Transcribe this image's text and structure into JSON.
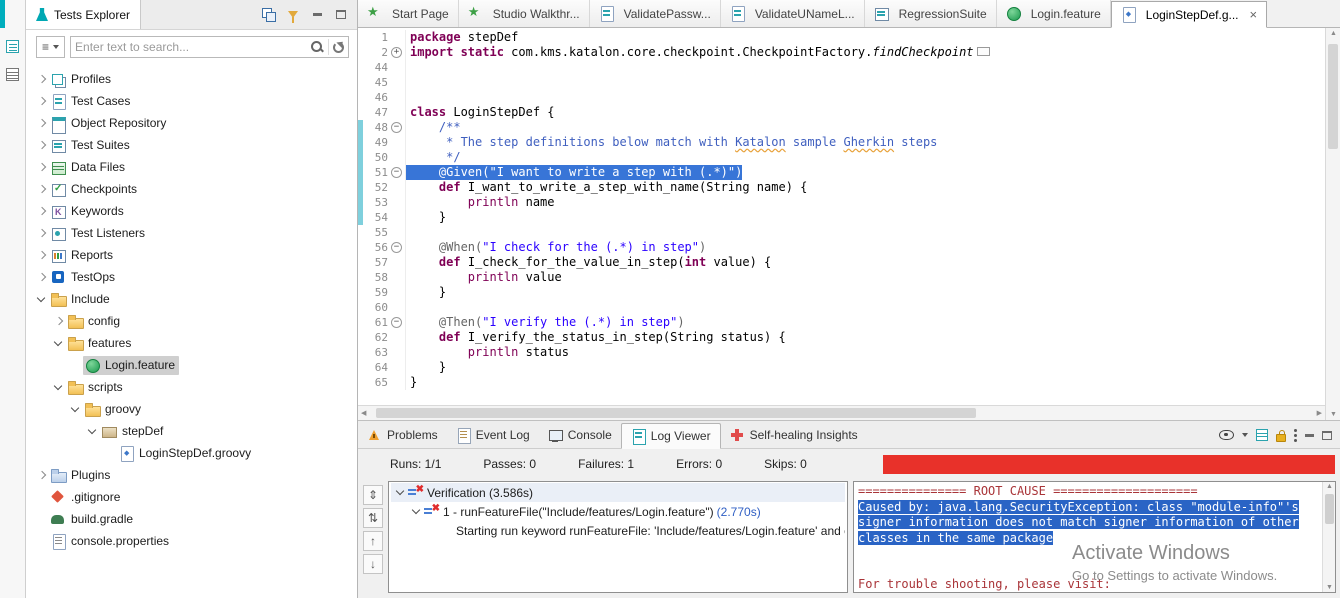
{
  "colors": {
    "accent_teal": "#00aebd",
    "selection_blue": "#3875d7",
    "console_selection": "#2a64c5",
    "failure_red": "#e8312a",
    "keyword_purple": "#7f0055",
    "string_blue": "#2a00ff",
    "comment_blue": "#3f5fbf",
    "root_cause_red": "#a93438"
  },
  "explorer": {
    "tab": "Tests Explorer",
    "search_placeholder": "Enter text to search...",
    "tree": [
      {
        "label": "Profiles",
        "icon": "profiles",
        "lvl": 0,
        "ch": "c"
      },
      {
        "label": "Test Cases",
        "icon": "testcase",
        "lvl": 0,
        "ch": "c"
      },
      {
        "label": "Object Repository",
        "icon": "objrepo",
        "lvl": 0,
        "ch": "c"
      },
      {
        "label": "Test Suites",
        "icon": "suite",
        "lvl": 0,
        "ch": "c"
      },
      {
        "label": "Data Files",
        "icon": "datafile",
        "lvl": 0,
        "ch": "c"
      },
      {
        "label": "Checkpoints",
        "icon": "checkpoint",
        "lvl": 0,
        "ch": "c"
      },
      {
        "label": "Keywords",
        "icon": "keyword",
        "lvl": 0,
        "ch": "c"
      },
      {
        "label": "Test Listeners",
        "icon": "listener",
        "lvl": 0,
        "ch": "c"
      },
      {
        "label": "Reports",
        "icon": "report",
        "lvl": 0,
        "ch": "c"
      },
      {
        "label": "TestOps",
        "icon": "testops",
        "lvl": 0,
        "ch": "c"
      },
      {
        "label": "Include",
        "icon": "folder",
        "lvl": 0,
        "ch": "e"
      },
      {
        "label": "config",
        "icon": "folder",
        "lvl": 1,
        "ch": "c"
      },
      {
        "label": "features",
        "icon": "folder",
        "lvl": 1,
        "ch": "e"
      },
      {
        "label": "Login.feature",
        "icon": "feature",
        "lvl": 2,
        "ch": "n",
        "selected": true
      },
      {
        "label": "scripts",
        "icon": "folder",
        "lvl": 1,
        "ch": "e"
      },
      {
        "label": "groovy",
        "icon": "folder",
        "lvl": 2,
        "ch": "e"
      },
      {
        "label": "stepDef",
        "icon": "stepdef",
        "lvl": 3,
        "ch": "e"
      },
      {
        "label": "LoginStepDef.groovy",
        "icon": "groovyfile",
        "lvl": 4,
        "ch": "n"
      },
      {
        "label": "Plugins",
        "icon": "plugins",
        "lvl": 0,
        "ch": "c"
      },
      {
        "label": ".gitignore",
        "icon": "git",
        "lvl": 0,
        "ch": "n"
      },
      {
        "label": "build.gradle",
        "icon": "gradle",
        "lvl": 0,
        "ch": "n"
      },
      {
        "label": "console.properties",
        "icon": "props",
        "lvl": 0,
        "ch": "n"
      }
    ]
  },
  "editor": {
    "close_glyph": "×",
    "tabs": [
      {
        "label": "Start Page",
        "icon": "star"
      },
      {
        "label": "Studio Walkthr...",
        "icon": "star"
      },
      {
        "label": "ValidatePassw...",
        "icon": "testcase2"
      },
      {
        "label": "ValidateUNameL...",
        "icon": "testcase2"
      },
      {
        "label": "RegressionSuite",
        "icon": "suite2"
      },
      {
        "label": "Login.feature",
        "icon": "feature"
      },
      {
        "label": "LoginStepDef.g...",
        "icon": "groovyfile",
        "active": true
      }
    ],
    "lines": [
      {
        "num": "1",
        "tokens": [
          [
            "kw",
            "package"
          ],
          [
            "pl",
            " stepDef"
          ]
        ]
      },
      {
        "num": "2",
        "fold": "+",
        "tokens": [
          [
            "kw",
            "import static"
          ],
          [
            "pl",
            " com.kms.katalon.core.checkpoint.CheckpointFactory."
          ],
          [
            "it",
            "findCheckpoint"
          ],
          [
            "box",
            ""
          ]
        ]
      },
      {
        "num": "44",
        "tokens": []
      },
      {
        "num": "45",
        "tokens": []
      },
      {
        "num": "46",
        "tokens": []
      },
      {
        "num": "47",
        "tokens": [
          [
            "kw",
            "class"
          ],
          [
            "pl",
            " LoginStepDef {"
          ]
        ]
      },
      {
        "num": "48",
        "fold": "-",
        "chg": true,
        "tokens": [
          [
            "cm",
            "    /**"
          ]
        ]
      },
      {
        "num": "49",
        "chg": true,
        "tokens": [
          [
            "cm",
            "     * The step definitions below match with "
          ],
          [
            "cmw",
            "Katalon"
          ],
          [
            "cm",
            " sample "
          ],
          [
            "cmw",
            "Gherkin"
          ],
          [
            "cm",
            " steps"
          ]
        ]
      },
      {
        "num": "50",
        "chg": true,
        "tokens": [
          [
            "cm",
            "     */"
          ]
        ]
      },
      {
        "num": "51",
        "fold": "-",
        "chg": true,
        "sel": true,
        "tokens": [
          [
            "ann",
            "    @Given("
          ],
          [
            "str",
            "\"I want to write a step with (.*)\""
          ],
          [
            "ann",
            ")"
          ]
        ]
      },
      {
        "num": "52",
        "chg": true,
        "tokens": [
          [
            "pl",
            "    "
          ],
          [
            "kw",
            "def"
          ],
          [
            "pl",
            " I_want_to_write_a_step_with_name(String name) {"
          ]
        ]
      },
      {
        "num": "53",
        "chg": true,
        "tokens": [
          [
            "pl",
            "        "
          ],
          [
            "kw2",
            "println"
          ],
          [
            "pl",
            " name"
          ]
        ]
      },
      {
        "num": "54",
        "chg": true,
        "tokens": [
          [
            "pl",
            "    }"
          ]
        ]
      },
      {
        "num": "55",
        "tokens": []
      },
      {
        "num": "56",
        "fold": "-",
        "tokens": [
          [
            "ann",
            "    @When("
          ],
          [
            "str",
            "\"I check for the (.*) in step\""
          ],
          [
            "ann",
            ")"
          ]
        ]
      },
      {
        "num": "57",
        "tokens": [
          [
            "pl",
            "    "
          ],
          [
            "kw",
            "def"
          ],
          [
            "pl",
            " I_check_for_the_value_in_step("
          ],
          [
            "kw",
            "int"
          ],
          [
            "pl",
            " value) {"
          ]
        ]
      },
      {
        "num": "58",
        "tokens": [
          [
            "pl",
            "        "
          ],
          [
            "kw2",
            "println"
          ],
          [
            "pl",
            " value"
          ]
        ]
      },
      {
        "num": "59",
        "tokens": [
          [
            "pl",
            "    }"
          ]
        ]
      },
      {
        "num": "60",
        "tokens": []
      },
      {
        "num": "61",
        "fold": "-",
        "tokens": [
          [
            "ann",
            "    @Then("
          ],
          [
            "str",
            "\"I verify the (.*) in step\""
          ],
          [
            "ann",
            ")"
          ]
        ]
      },
      {
        "num": "62",
        "tokens": [
          [
            "pl",
            "    "
          ],
          [
            "kw",
            "def"
          ],
          [
            "pl",
            " I_verify_the_status_in_step(String status) {"
          ]
        ]
      },
      {
        "num": "63",
        "tokens": [
          [
            "pl",
            "        "
          ],
          [
            "kw2",
            "println"
          ],
          [
            "pl",
            " status"
          ]
        ]
      },
      {
        "num": "64",
        "tokens": [
          [
            "pl",
            "    }"
          ]
        ]
      },
      {
        "num": "65",
        "tokens": [
          [
            "pl",
            "}"
          ]
        ]
      }
    ]
  },
  "bottom": {
    "tabs": [
      {
        "label": "Problems",
        "icon": "problems"
      },
      {
        "label": "Event Log",
        "icon": "eventlog"
      },
      {
        "label": "Console",
        "icon": "console"
      },
      {
        "label": "Log Viewer",
        "icon": "logviewer",
        "active": true
      },
      {
        "label": "Self-healing Insights",
        "icon": "selfheal"
      }
    ],
    "stats": [
      "Runs: 1/1",
      "Passes: 0",
      "Failures: 1",
      "Errors: 0",
      "Skips: 0"
    ],
    "tools": [
      {
        "name": "expand-collapse",
        "glyph": "⇕"
      },
      {
        "name": "scroll-sync",
        "glyph": "⇅"
      },
      {
        "name": "previous-failure",
        "glyph": "↑"
      },
      {
        "name": "next-failure",
        "glyph": "↓"
      }
    ],
    "log_tree": [
      {
        "lvl": 0,
        "chev": true,
        "icon": true,
        "text": "Verification (3.586s)",
        "hl": true
      },
      {
        "lvl": 1,
        "chev": true,
        "icon": true,
        "text": "1 - runFeatureFile(\"Include/features/Login.feature\")",
        "time": "(2.770s)"
      },
      {
        "lvl": 3,
        "chev": false,
        "icon": false,
        "text": "Starting run keyword runFeatureFile: 'Include/features/Login.feature' and e"
      }
    ],
    "console": {
      "lines": [
        {
          "s": "err",
          "t": "=============== ROOT CAUSE ===================="
        },
        {
          "s": "sel",
          "t": "Caused by: java.lang.SecurityException: class \"module-info\"'s"
        },
        {
          "s": "sel",
          "t": "signer information does not match signer information of other"
        },
        {
          "s": "sel",
          "t": "classes in the same package"
        },
        {
          "s": "plain",
          "t": ""
        },
        {
          "s": "plain",
          "t": ""
        },
        {
          "s": "err",
          "t": "For trouble shooting, please visit:"
        }
      ]
    }
  },
  "watermark": {
    "line1": "Activate Windows",
    "line2": "Go to Settings to activate Windows."
  }
}
